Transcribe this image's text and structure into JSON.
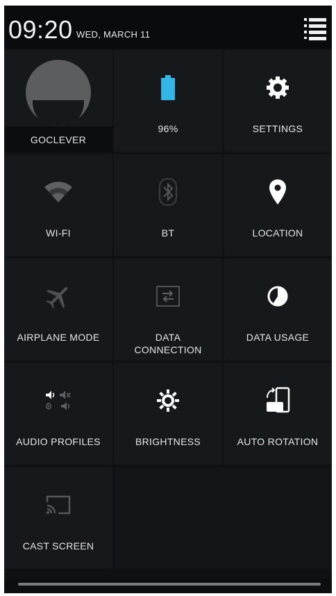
{
  "status": {
    "time": "09:20",
    "date": "WED, MARCH 11"
  },
  "tiles": [
    {
      "label": "GOCLEVER",
      "icon": "user-avatar-icon",
      "state": "on"
    },
    {
      "label": "96%",
      "icon": "battery-icon",
      "state": "on",
      "color": "#33b5e5"
    },
    {
      "label": "SETTINGS",
      "icon": "gear-icon",
      "state": "on"
    },
    {
      "label": "WI-FI",
      "icon": "wifi-icon",
      "state": "off"
    },
    {
      "label": "BT",
      "icon": "bluetooth-icon",
      "state": "off"
    },
    {
      "label": "LOCATION",
      "icon": "location-pin-icon",
      "state": "on"
    },
    {
      "label": "AIRPLANE MODE",
      "icon": "airplane-icon",
      "state": "off"
    },
    {
      "label": "DATA CONNECTION",
      "line1": "DATA",
      "line2": "CONNECTION",
      "icon": "data-connection-icon",
      "state": "off"
    },
    {
      "label": "DATA USAGE",
      "icon": "data-usage-icon",
      "state": "on"
    },
    {
      "label": "AUDIO PROFILES",
      "icon": "audio-profiles-icon",
      "state": "on"
    },
    {
      "label": "BRIGHTNESS",
      "icon": "brightness-icon",
      "state": "on"
    },
    {
      "label": "AUTO ROTATION",
      "icon": "auto-rotation-icon",
      "state": "on"
    },
    {
      "label": "CAST SCREEN",
      "icon": "cast-screen-icon",
      "state": "off"
    }
  ],
  "colors": {
    "active_icon": "#ffffff",
    "inactive_icon": "#6b6e70",
    "battery": "#33b5e5"
  }
}
